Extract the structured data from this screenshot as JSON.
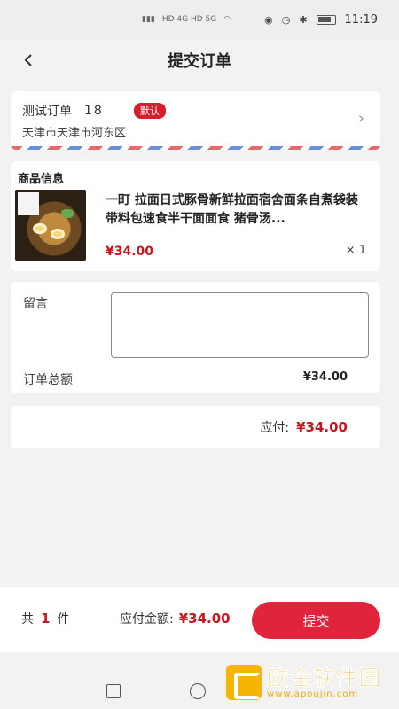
{
  "status_bar": {
    "indicators": "HD 4G HD 5G",
    "time": "11:19"
  },
  "header": {
    "back_icon": "chevron-left-icon",
    "title": "提交订单"
  },
  "address": {
    "name": "测试订单",
    "phone": "18",
    "badge": "默认",
    "detail": "天津市天津市河东区",
    "chevron": "›"
  },
  "goods": {
    "section_title": "商品信息",
    "title": "一町 拉面日式豚骨新鲜拉面宿舍面条自煮袋装带料包速食半干面面食 猪骨汤...",
    "price": "¥34.00",
    "quantity": "× 1"
  },
  "remark": {
    "label": "留言",
    "value": "",
    "placeholder": ""
  },
  "order_total": {
    "label": "订单总额",
    "value": "¥34.00"
  },
  "payable": {
    "label": "应付:",
    "value": "¥34.00"
  },
  "bottom_bar": {
    "count_prefix": "共",
    "count": "1",
    "count_suffix": "件",
    "amount_label": "应付金额:",
    "amount_value": "¥34.00",
    "submit_label": "提交"
  },
  "watermark": {
    "cn": "欧金软件园",
    "en": "www.apoujin.com"
  },
  "colors": {
    "accent": "#e0243c",
    "price": "#c8161d",
    "background": "#f2f2f2"
  }
}
